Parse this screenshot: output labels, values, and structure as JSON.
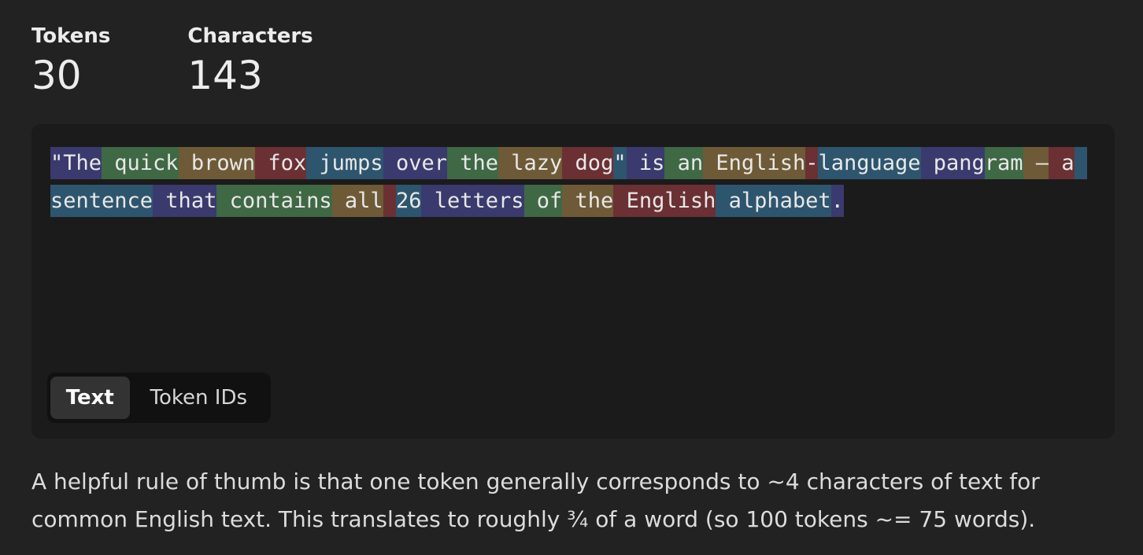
{
  "stats": {
    "tokens_label": "Tokens",
    "tokens_value": "30",
    "characters_label": "Characters",
    "characters_value": "143"
  },
  "tokens": [
    "\"The",
    " quick",
    " brown",
    " fox",
    " jumps",
    " over",
    " the",
    " lazy",
    " dog",
    "\"",
    " is",
    " an",
    " English",
    "-",
    "language",
    " pang",
    "ram",
    " —",
    " a",
    " sentence",
    " that",
    " contains",
    " all",
    " ",
    "26",
    " letters",
    " of",
    " the",
    " English",
    " alphabet",
    "."
  ],
  "token_colors": [
    "#3a3a6e",
    "#3f6844",
    "#6e5a37",
    "#6b3033",
    "#2e556e"
  ],
  "view_toggle": {
    "text_label": "Text",
    "token_ids_label": "Token IDs",
    "selected": "Text"
  },
  "help_text": "A helpful rule of thumb is that one token generally corresponds to ~4 characters of text for common English text. This translates to roughly ¾ of a word (so 100 tokens ~= 75 words)."
}
